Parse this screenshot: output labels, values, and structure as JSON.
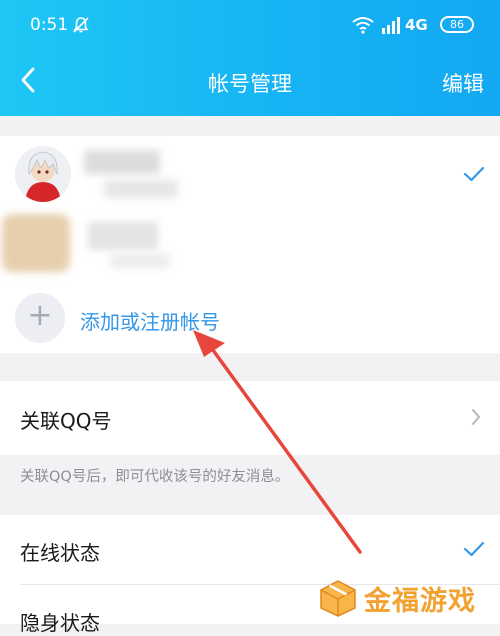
{
  "status_bar": {
    "time": "0:51",
    "network": "4G",
    "battery": "86"
  },
  "navbar": {
    "title": "帐号管理",
    "edit_label": "编辑"
  },
  "accounts": {
    "add_label": "添加或注册帐号"
  },
  "link_qq": {
    "label": "关联QQ号",
    "description": "关联QQ号后，即可代收该号的好友消息。"
  },
  "status": {
    "online_label": "在线状态",
    "hidden_label": "隐身状态"
  },
  "watermark": {
    "text": "金福游戏",
    "url": "www.yikajinfu.com"
  },
  "colors": {
    "header_start": "#1ec7f5",
    "header_end": "#12a8f2",
    "accent": "#3597e8",
    "arrow": "#e8453c"
  }
}
